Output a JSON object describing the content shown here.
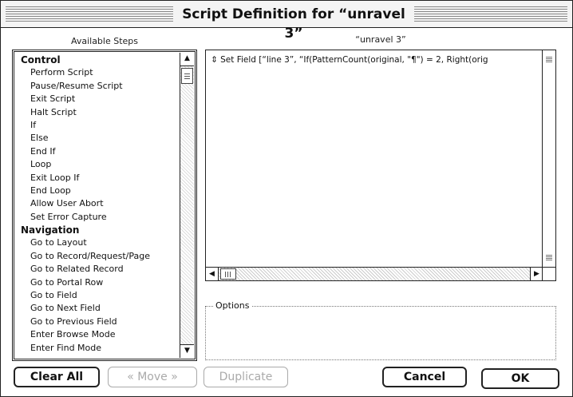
{
  "window": {
    "title": "Script Definition for “unravel 3”"
  },
  "steps_panel": {
    "caption": "Available Steps",
    "items": [
      {
        "label": "Control",
        "heading": true
      },
      {
        "label": "Perform Script"
      },
      {
        "label": "Pause/Resume Script"
      },
      {
        "label": "Exit Script"
      },
      {
        "label": "Halt Script"
      },
      {
        "label": "If"
      },
      {
        "label": "Else"
      },
      {
        "label": "End If"
      },
      {
        "label": "Loop"
      },
      {
        "label": "Exit Loop If"
      },
      {
        "label": "End Loop"
      },
      {
        "label": "Allow User Abort"
      },
      {
        "label": "Set Error Capture"
      },
      {
        "label": "Navigation",
        "heading": true
      },
      {
        "label": "Go to Layout"
      },
      {
        "label": "Go to Record/Request/Page"
      },
      {
        "label": "Go to Related Record"
      },
      {
        "label": "Go to Portal Row"
      },
      {
        "label": "Go to Field"
      },
      {
        "label": "Go to Next Field"
      },
      {
        "label": "Go to Previous Field"
      },
      {
        "label": "Enter Browse Mode"
      },
      {
        "label": "Enter Find Mode"
      }
    ],
    "scroll_up_icon": "▲",
    "scroll_down_icon": "▼"
  },
  "script_panel": {
    "caption": "“unravel 3”",
    "lines": [
      "⇕ Set Field [“line 3”, “If(PatternCount(original, \"¶\") = 2, Right(orig"
    ],
    "scroll_left_icon": "◀",
    "scroll_right_icon": "▶"
  },
  "options": {
    "label": "Options"
  },
  "buttons": {
    "clear_all": "Clear All",
    "move": "« Move »",
    "duplicate": "Duplicate",
    "cancel": "Cancel",
    "ok": "OK"
  }
}
